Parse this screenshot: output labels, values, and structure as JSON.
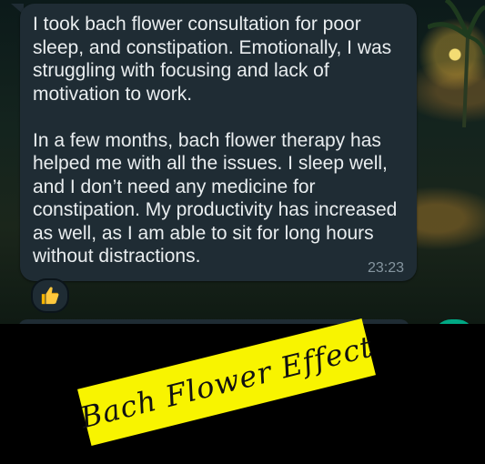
{
  "chat": {
    "message": "I took bach flower consultation for poor sleep, and constipation. Emotionally, I was struggling with focusing and lack of motivation to work.\n\nIn a few months, bach flower therapy has helped me with all the issues. I sleep well, and I don’t need any medicine for constipation. My productivity has increased as well, as I am able to sit for long hours without distractions.",
    "time": "23:23",
    "reaction": "thumbs-up-icon"
  },
  "overlay": {
    "caption": "Bach Flower Effect"
  },
  "colors": {
    "bubble": "#1f2c34",
    "text": "#e9edef",
    "timestamp": "#8696a0",
    "banner": "#f8f400",
    "accent_green": "#00a884"
  }
}
